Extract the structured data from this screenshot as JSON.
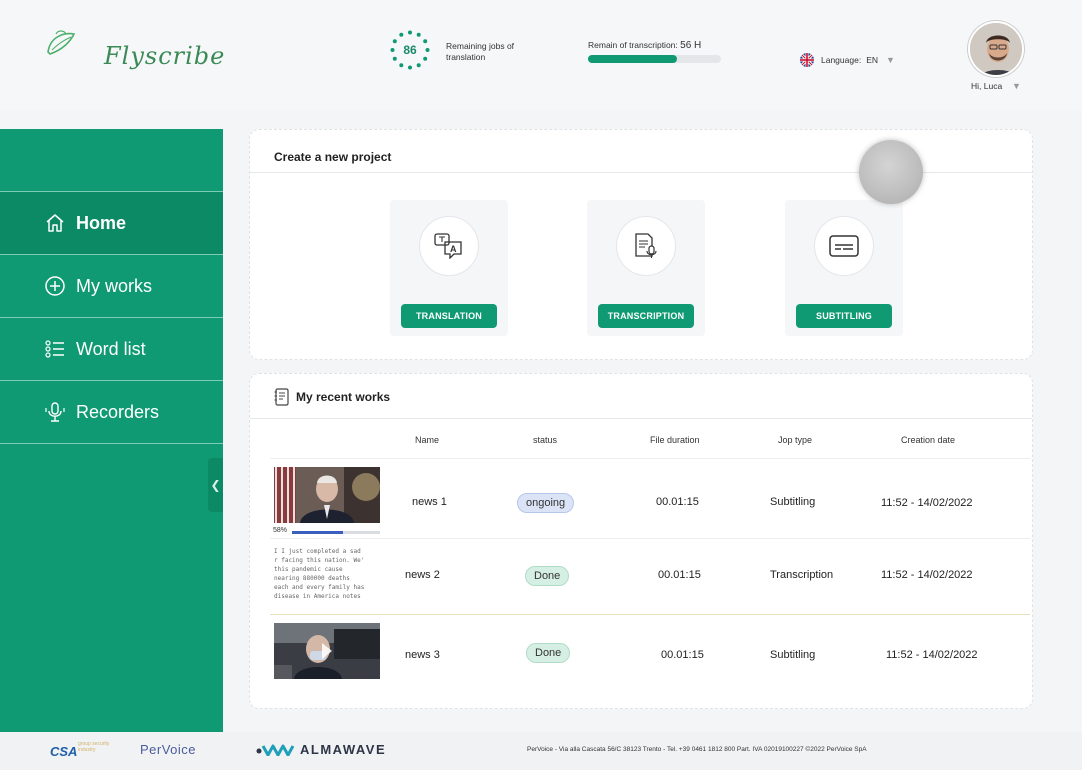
{
  "header": {
    "logo_text": "Flyscribe",
    "jobs_count": "86",
    "jobs_label": "Remaining jobs of translation",
    "transcription_label": "Remain of transcription:",
    "transcription_value": "56 H",
    "transcription_fraction": 0.67,
    "language_label": "Language:",
    "language_value": "EN",
    "user_greeting": "Hi, Luca"
  },
  "sidebar": {
    "items": [
      {
        "label": "Home",
        "icon": "home-icon"
      },
      {
        "label": "My works",
        "icon": "plus-circle-icon"
      },
      {
        "label": "Word list",
        "icon": "list-icon"
      },
      {
        "label": "Recorders",
        "icon": "microphone-icon"
      }
    ],
    "collapse_icon": "chevron-left-icon"
  },
  "new_project": {
    "title": "Create a new project",
    "options": [
      {
        "label": "TRANSLATION",
        "icon": "translate-icon"
      },
      {
        "label": "TRANSCRIPTION",
        "icon": "document-mic-icon"
      },
      {
        "label": "SUBTITLING",
        "icon": "subtitles-icon"
      }
    ]
  },
  "recent": {
    "title": "My recent  works",
    "columns": [
      "Name",
      "status",
      "File duration",
      "Jop type",
      "Creation date"
    ],
    "rows": [
      {
        "name": "news 1",
        "status": "ongoing",
        "duration": "00.01:15",
        "type": "Subtitling",
        "date": "11:52 - 14/02/2022",
        "progress_label": "58%",
        "progress": 0.58
      },
      {
        "name": "news 2",
        "status": "Done",
        "duration": "00.01:15",
        "type": "Transcription",
        "date": "11:52 - 14/02/2022",
        "thumb_lines": [
          "I I just completed a sad",
          "r facing this nation. We'",
          "  this  pandemic  cause",
          "  nearing  880000  deaths",
          "each and every family has",
          "disease in America notes"
        ]
      },
      {
        "name": "news 3",
        "status": "Done",
        "duration": "00.01:15",
        "type": "Subtitling",
        "date": "11:52 - 14/02/2022"
      }
    ]
  },
  "footer": {
    "csa": "CSA",
    "csa_sub": "group security industry",
    "pervoice": "PerVoice",
    "almawave": "ALMAWAVE",
    "note": "PerVoice - Via alla Cascata 56/C 38123 Trento - Tel. +39 0461 1812 800 Part. IVA 02019100227 ©2022 PerVoice SpA"
  }
}
